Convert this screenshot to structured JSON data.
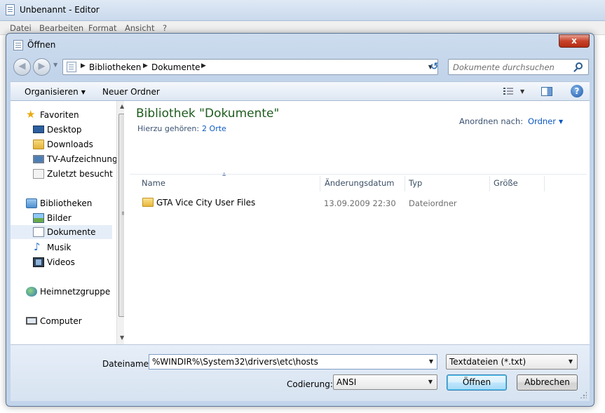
{
  "notepad": {
    "title": "Unbenannt - Editor",
    "menu": [
      "Datei",
      "Bearbeiten",
      "Format",
      "Ansicht",
      "?"
    ]
  },
  "dialog": {
    "title": "Öffnen",
    "close_label": "x"
  },
  "address": {
    "crumbs": [
      "Bibliotheken",
      "Dokumente"
    ],
    "search_placeholder": "Dokumente durchsuchen"
  },
  "toolbar": {
    "organize": "Organisieren",
    "new_folder": "Neuer Ordner",
    "help": "?"
  },
  "nav": {
    "favorites": {
      "label": "Favoriten",
      "items": [
        "Desktop",
        "Downloads",
        "TV-Aufzeichnungen",
        "Zuletzt besucht"
      ]
    },
    "libraries": {
      "label": "Bibliotheken",
      "items": [
        "Bilder",
        "Dokumente",
        "Musik",
        "Videos"
      ],
      "selected": "Dokumente"
    },
    "homegroup": "Heimnetzgruppe",
    "computer": "Computer"
  },
  "content": {
    "library_title": "Bibliothek \"Dokumente\"",
    "includes_label": "Hierzu gehören:",
    "includes_link": "2 Orte",
    "arrange_label": "Anordnen nach:",
    "arrange_value": "Ordner",
    "columns": [
      "Name",
      "Änderungsdatum",
      "Typ",
      "Größe"
    ],
    "files": [
      {
        "name": "GTA Vice City User Files",
        "date": "13.09.2009 22:30",
        "type": "Dateiordner",
        "size": ""
      }
    ]
  },
  "bottom": {
    "filename_label": "Dateiname:",
    "filename_value": "%WINDIR%\\System32\\drivers\\etc\\hosts",
    "filter_value": "Textdateien (*.txt)",
    "encoding_label": "Codierung:",
    "encoding_value": "ANSI",
    "open_button": "Öffnen",
    "cancel_button": "Abbrechen"
  }
}
